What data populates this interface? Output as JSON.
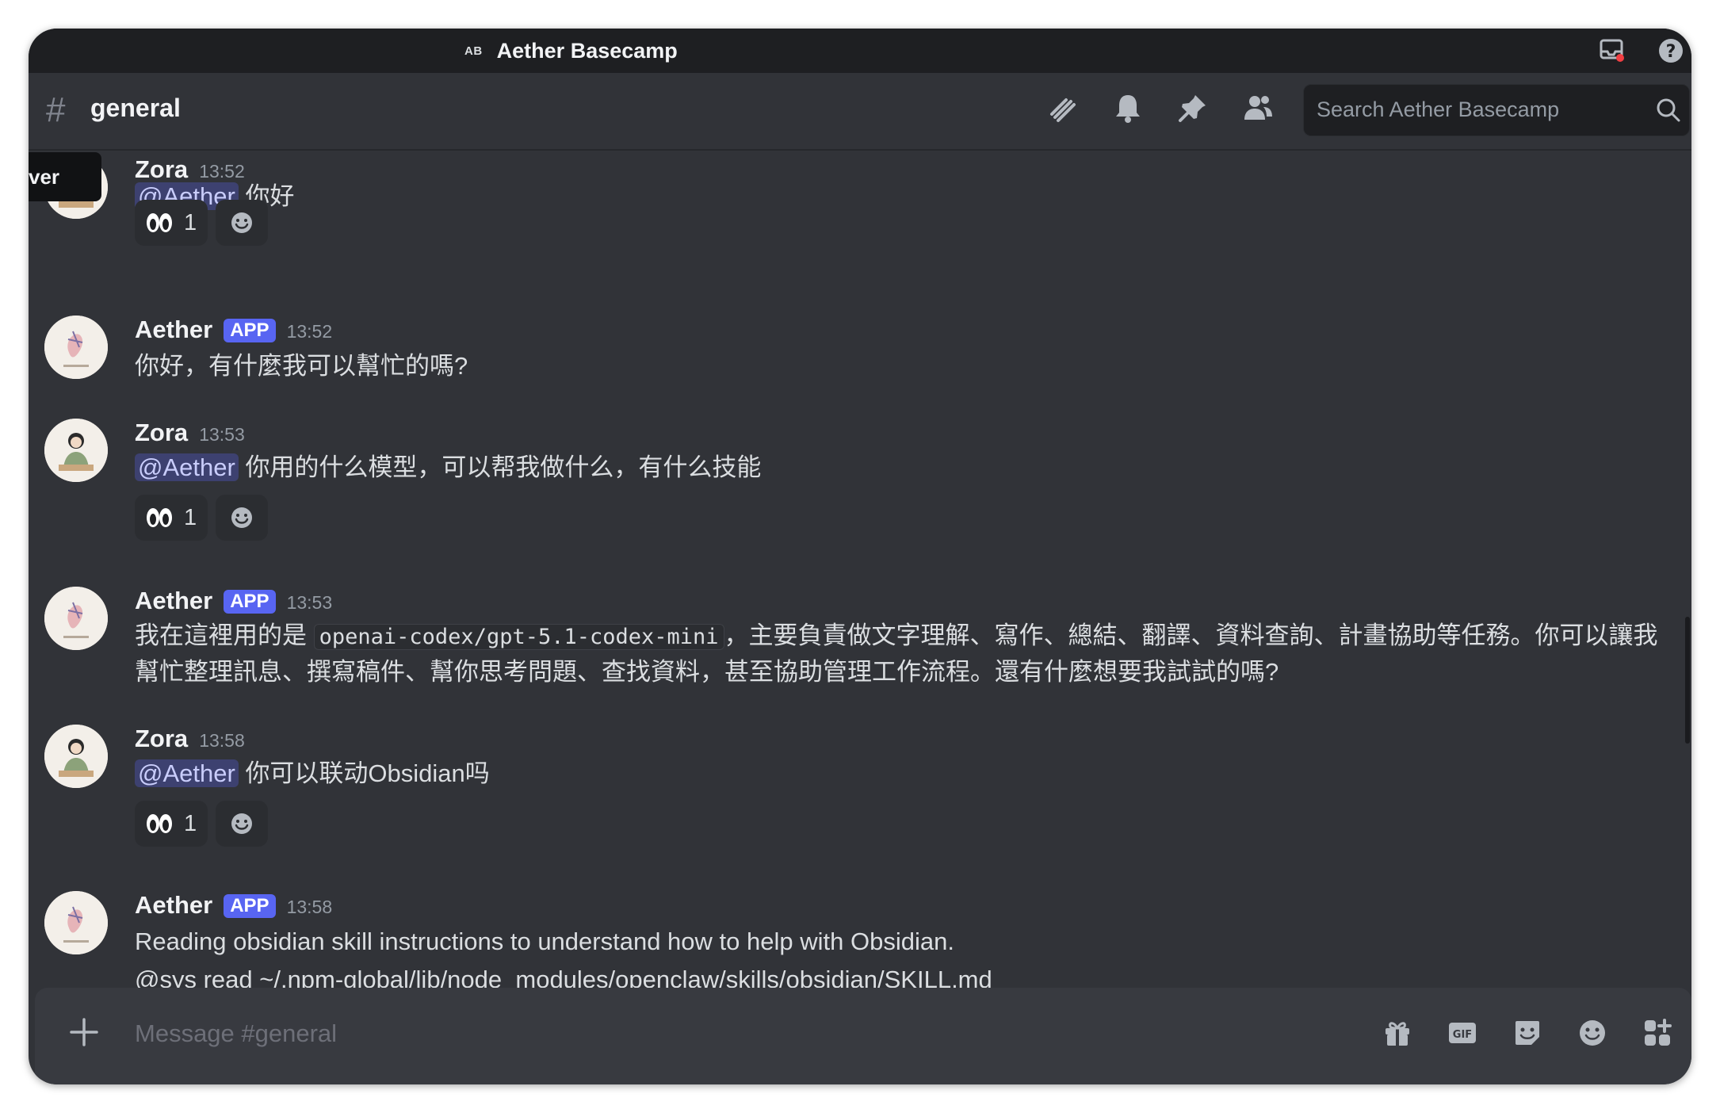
{
  "window": {
    "server_abbr": "AB",
    "server_name": "Aether Basecamp"
  },
  "channel": {
    "hash": "#",
    "name": "general",
    "search_placeholder": "Search Aether Basecamp"
  },
  "tooltip": {
    "text": "ver"
  },
  "messages": [
    {
      "author": "Zora",
      "badge": "",
      "time": "13:52",
      "mention": "@Aether",
      "text": "你好",
      "reactions": [
        {
          "emoji": "eyes-icon",
          "count": "1"
        }
      ]
    },
    {
      "author": "Aether",
      "badge": "APP",
      "time": "13:52",
      "text": "你好，有什麼我可以幫忙的嗎?"
    },
    {
      "author": "Zora",
      "badge": "",
      "time": "13:53",
      "mention": "@Aether",
      "text": "你用的什么模型，可以帮我做什么，有什么技能",
      "reactions": [
        {
          "emoji": "eyes-icon",
          "count": "1"
        }
      ]
    },
    {
      "author": "Aether",
      "badge": "APP",
      "time": "13:53",
      "text_before": "我在這裡用的是 ",
      "code": "openai-codex/gpt-5.1-codex-mini",
      "text_after": "，主要負責做文字理解、寫作、總結、翻譯、資料查詢、計畫協助等任務。你可以讓我幫忙整理訊息、撰寫稿件、幫你思考問題、查找資料，甚至協助管理工作流程。還有什麼想要我試試的嗎?"
    },
    {
      "author": "Zora",
      "badge": "",
      "time": "13:58",
      "mention": "@Aether",
      "text": "你可以联动Obsidian吗",
      "reactions": [
        {
          "emoji": "eyes-icon",
          "count": "1"
        }
      ]
    },
    {
      "author": "Aether",
      "badge": "APP",
      "time": "13:58",
      "text": "Reading obsidian skill instructions to understand how to help with Obsidian.",
      "text2": "@sys read ~/.npm-global/lib/node_modules/openclaw/skills/obsidian/SKILL.md"
    }
  ],
  "composer": {
    "placeholder": "Message #general"
  },
  "colors": {
    "background": "#313338",
    "accent": "#5865f2",
    "titlebar": "#1e1f22"
  }
}
